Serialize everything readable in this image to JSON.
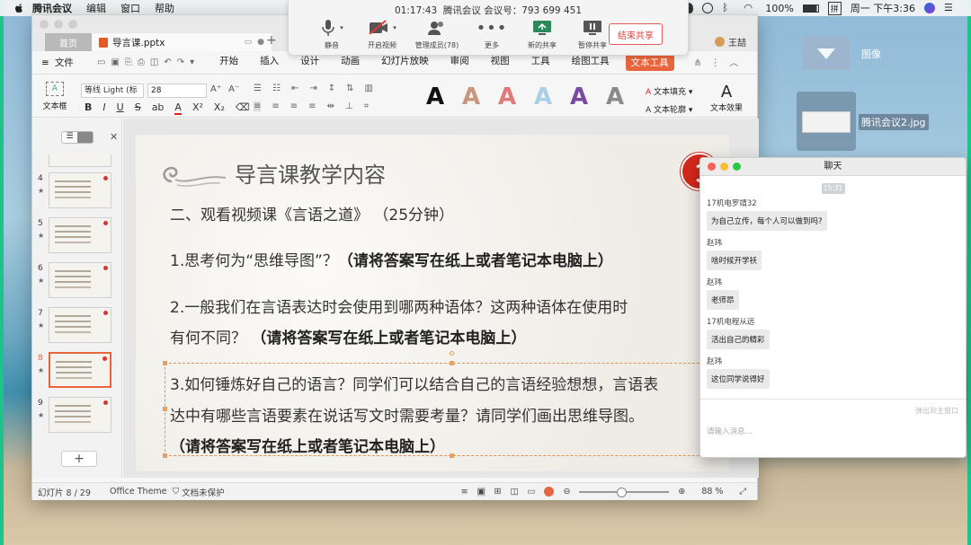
{
  "menubar": {
    "app": "腾讯会议",
    "menus": [
      "编辑",
      "窗口",
      "帮助"
    ],
    "battery": "100%",
    "input_method": "拼",
    "datetime": "周一 下午3:36"
  },
  "meeting": {
    "timer": "01:17:43",
    "meeting_label": "腾讯会议 会议号：793 699 451",
    "buttons": [
      "静音",
      "开启视频",
      "管理成员(78)",
      "更多",
      "新的共享",
      "暂停共享"
    ],
    "end_share": "结束共享"
  },
  "wps": {
    "home_tab": "首页",
    "doc_tab": "导言课.pptx",
    "user": "王喆",
    "file_menu": "文件",
    "ribbon_tabs": [
      "开始",
      "插入",
      "设计",
      "动画",
      "幻灯片放映",
      "审阅",
      "视图",
      "工具",
      "绘图工具",
      "文本工具"
    ],
    "textbox_label": "文本框",
    "font_name": "等线 Light (标",
    "font_size": "28",
    "text_fill": "文本填充",
    "text_outline": "文本轮廓",
    "text_effect": "文本效果",
    "style_letter": "A",
    "style_colors": [
      "#111111",
      "#c8967a",
      "#e07a78",
      "#a8d0e6",
      "#7a4aa0",
      "#8a8a8a"
    ]
  },
  "slides": {
    "numbers": [
      "4",
      "5",
      "6",
      "7",
      "8",
      "9"
    ],
    "selected": "8"
  },
  "slide": {
    "title": "导言课教学内容",
    "line1": "二、观看视频课《言语之道》    （25分钟）",
    "q1_text": "1.思考何为“思维导图”？",
    "q1_bold": "（请将答案写在纸上或者笔记本电脑上）",
    "q2_line1": "2.一般我们在言语表达时会使用到哪两种语体？这两种语体在使用时",
    "q2_line2": "有何不同？",
    "q2_bold": "（请将答案写在纸上或者笔记本电脑上）",
    "q3_line1": "3.如何锤炼好自己的语言？同学们可以结合自己的言语经验想想，言语表",
    "q3_line2": "达中有哪些言语要素在说话写文时需要考量？请同学们画出思维导图。",
    "q3_bold": "（请将答案写在纸上或者笔记本电脑上）"
  },
  "status": {
    "slide_counter": "幻灯片 8 / 29",
    "theme": "Office Theme",
    "protect": "文档未保护",
    "zoom": "88 %",
    "zoom_fraction": 0.44
  },
  "chat": {
    "title": "聊天",
    "time": "15:31",
    "messages": [
      {
        "sender": "17机电罗靖32",
        "text": "为自己立传，每个人可以做到吗?"
      },
      {
        "sender": "赵玮",
        "text": "啥时候开学袄"
      },
      {
        "sender": "赵玮",
        "text": "老师昂"
      },
      {
        "sender": "17机电程从远",
        "text": "活出自己的精彩"
      },
      {
        "sender": "赵玮",
        "text": "这位同学说得好"
      }
    ],
    "hint": "弹出到主窗口",
    "input_placeholder": "请输入消息..."
  },
  "desktop": {
    "folder_label": "图像",
    "file_label": "腾讯会议2.jpg"
  }
}
